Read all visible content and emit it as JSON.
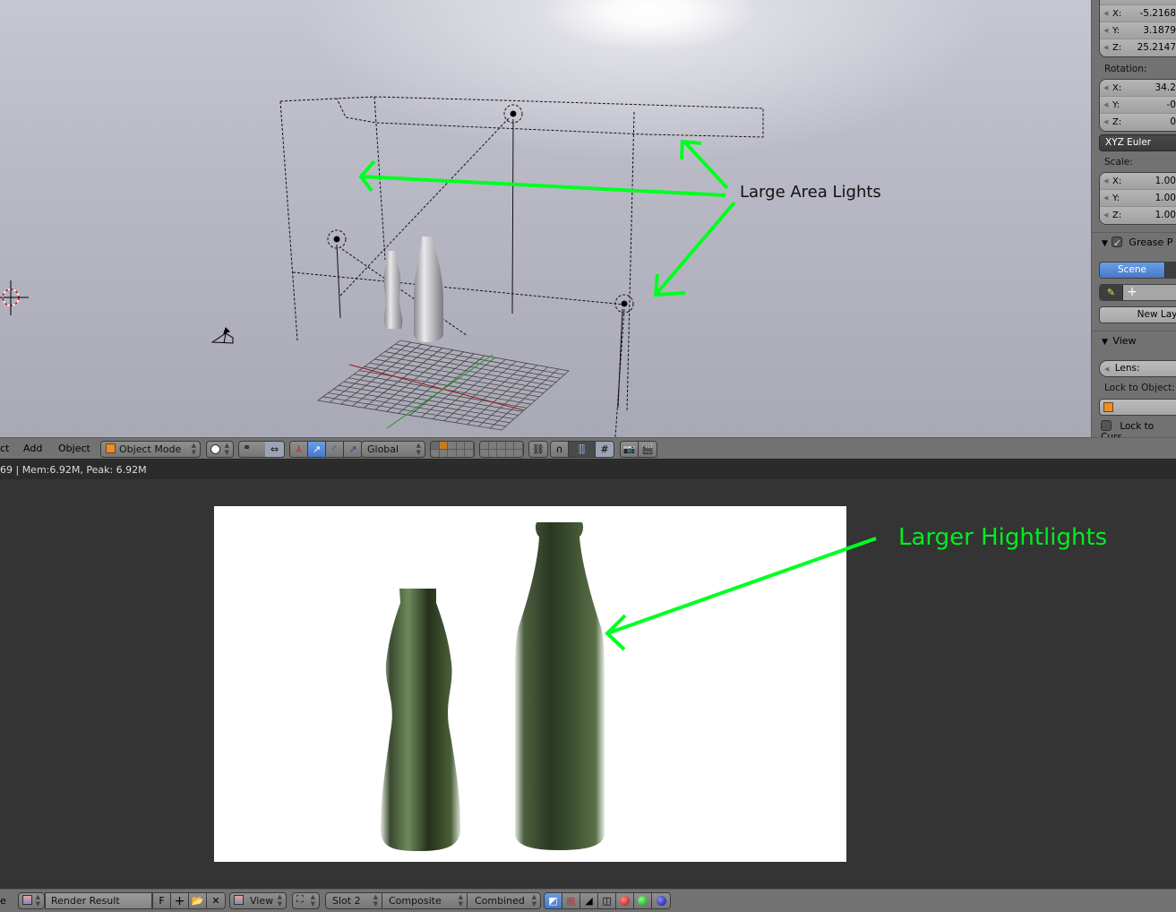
{
  "viewport": {
    "annotation_label": "Large Area Lights",
    "annotation_color": "#00ff22"
  },
  "properties_panel": {
    "location": {
      "x_label": "X:",
      "x": "-5.2168",
      "y_label": "Y:",
      "y": "3.1879",
      "z_label": "Z:",
      "z": "25.2147"
    },
    "rotation_label": "Rotation:",
    "rotation": {
      "x_label": "X:",
      "x": "34.2",
      "y_label": "Y:",
      "y": "-0",
      "z_label": "Z:",
      "z": "0"
    },
    "rotation_mode": "XYZ Euler",
    "scale_label": "Scale:",
    "scale": {
      "x_label": "X:",
      "x": "1.00",
      "y_label": "Y:",
      "y": "1.00",
      "z_label": "Z:",
      "z": "1.00"
    },
    "grease_pencil": {
      "title": "Grease P",
      "enabled": true,
      "scene_tab": "Scene",
      "new_label": "N",
      "new_layer_button": "New Lay"
    },
    "view": {
      "title": "View",
      "lens_label": "Lens:",
      "lock_to_object_label": "Lock to Object:",
      "lock_to_cursor_label": "Lock to Curs",
      "lock_to_cursor": false
    }
  },
  "view3d_header": {
    "menus": [
      "ct",
      "Add",
      "Object"
    ],
    "mode": "Object Mode",
    "orientation": "Global"
  },
  "info_bar": {
    "text": "69 | Mem:6.92M, Peak: 6.92M"
  },
  "image_editor": {
    "annotation_label": "Larger Hightlights",
    "annotation_color": "#00ff22"
  },
  "image_header": {
    "menu_partial": "e",
    "image_name": "Render Result",
    "fake_user": "F",
    "view_menu": "View",
    "slot": "Slot 2",
    "layer": "Composite",
    "pass": "Combined"
  }
}
